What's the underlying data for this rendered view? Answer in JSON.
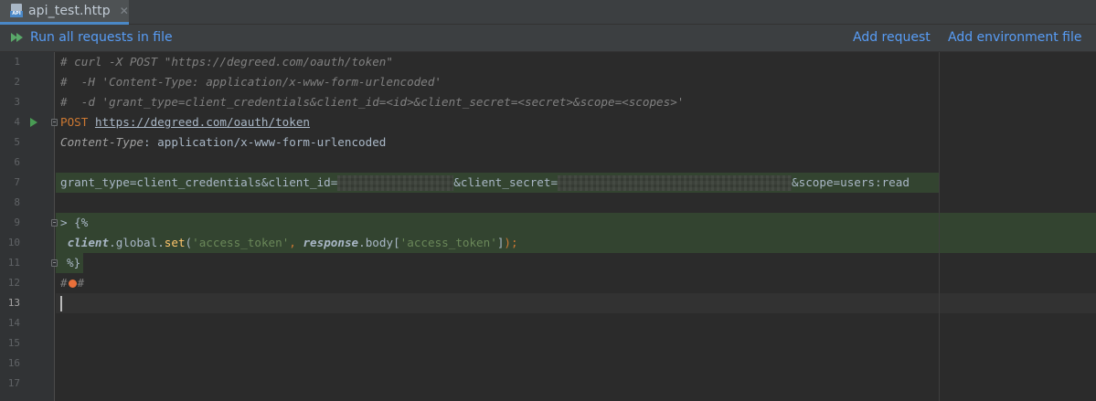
{
  "tab": {
    "title": "api_test.http",
    "close_glyph": "✕",
    "icon_label": "API"
  },
  "toolbar": {
    "run_all_label": "Run all requests in file",
    "add_request_label": "Add request",
    "add_env_label": "Add environment file"
  },
  "line_numbers": [
    "1",
    "2",
    "3",
    "4",
    "5",
    "6",
    "7",
    "8",
    "9",
    "10",
    "11",
    "12",
    "13",
    "14",
    "15",
    "16",
    "17"
  ],
  "code": {
    "l1": "# curl -X POST \"https://degreed.com/oauth/token\"",
    "l2": "#  -H 'Content-Type: application/x-www-form-urlencoded'",
    "l3": "#  -d 'grant_type=client_credentials&client_id=<id>&client_secret=<secret>&scope=<scopes>'",
    "l4_method": "POST",
    "l4_url": "https://degreed.com/oauth/token",
    "l5_name": "Content-Type",
    "l5_colon": ":",
    "l5_value": " application/x-www-form-urlencoded",
    "l7_a": "grant_type=client_credentials&client_id=",
    "l7_b": "&client_secret=",
    "l7_c": "&scope=users:read",
    "l9_gt": ">",
    "l9_open": " {%",
    "l10_client": "client",
    "l10_dot1": ".",
    "l10_global": "global",
    "l10_dot2": ".",
    "l10_set": "set",
    "l10_p1": "(",
    "l10_str1": "'access_token'",
    "l10_comma": ", ",
    "l10_response": "response",
    "l10_dot3": ".",
    "l10_body": "body",
    "l10_br1": "[",
    "l10_str2": "'access_token'",
    "l10_br2": "]",
    "l10_p2": ");",
    "l11": "%}",
    "l12_a": "#",
    "l12_b": "#"
  },
  "colors": {
    "accent": "#589df6",
    "run_green": "#499c54",
    "bulb": "#e9703a"
  },
  "icons": {
    "tab_icon": "api-file-icon",
    "run_all": "run-all-icon",
    "gutter_run": "run-request-icon",
    "intention": "intention-bulb-icon"
  }
}
